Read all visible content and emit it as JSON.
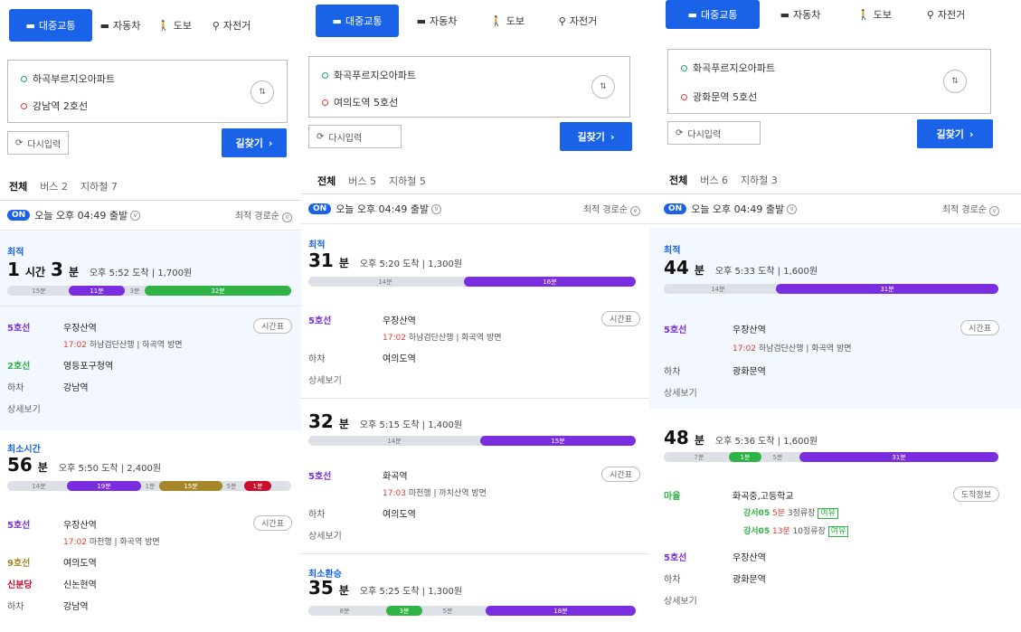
{
  "modes": {
    "transit": "대중교통",
    "car": "자동차",
    "walk": "도보",
    "bike": "자전거"
  },
  "common": {
    "later": "다시입력",
    "find": "길찾기",
    "timetable": "시간표",
    "detail": "상세보기",
    "alight": "하차",
    "sort": "최적 경로순"
  },
  "panel1": {
    "origin": "하곡부르지오아파트",
    "dest": "강남역 2호선",
    "tabs": [
      "전체",
      "버스 2",
      "지하철 7"
    ],
    "departure": "오늘 오후 04:49 출발",
    "route1": {
      "label": "최적",
      "time_a": "1",
      "unit_a": "시간",
      "time_b": "3",
      "unit_b": "분",
      "meta": "오후 5:52 도착 | 1,700원",
      "segs": [
        "15분",
        "11분",
        "3분",
        "32분"
      ],
      "leg1_line": "5호선",
      "leg1_stn": "우장산역",
      "leg1_sub_time": "17:02",
      "leg1_sub": "하남검단산행 | 하곡역 방면",
      "leg2_line": "2호선",
      "leg2_stn": "영등포구청역",
      "alight_stn": "강남역"
    },
    "route2": {
      "label": "최소시간",
      "time": "56",
      "unit": "분",
      "meta": "오후 5:50 도착 | 2,400원",
      "segs": [
        "14분",
        "19분",
        "1분",
        "15분",
        "5분",
        "1분"
      ],
      "leg1_line": "5호선",
      "leg1_stn": "우장산역",
      "leg1_sub_time": "17:02",
      "leg1_sub": "마천행 | 화곡역 방면",
      "leg2_line": "9호선",
      "leg2_stn": "여의도역",
      "leg3_line": "신분당",
      "leg3_stn": "신논현역",
      "alight_stn": "강남역"
    }
  },
  "panel2": {
    "origin": "화곡푸르지오아파트",
    "dest": "여의도역 5호선",
    "tabs": [
      "전체",
      "버스 5",
      "지하철 5"
    ],
    "departure": "오늘 오후 04:49 출발",
    "route1": {
      "label": "최적",
      "time": "31",
      "unit": "분",
      "meta": "오후 5:20 도착 | 1,300원",
      "segs": [
        "14분",
        "16분"
      ],
      "leg1_line": "5호선",
      "leg1_stn": "우장산역",
      "leg1_sub_time": "17:02",
      "leg1_sub": "하남검단산행 | 화곡역 방면",
      "alight_stn": "여의도역"
    },
    "route2": {
      "time": "32",
      "unit": "분",
      "meta": "오후 5:15 도착 | 1,400원",
      "segs": [
        "14분",
        "15분"
      ],
      "leg1_line": "5호선",
      "leg1_stn": "화곡역",
      "leg1_sub_time": "17:03",
      "leg1_sub": "마천행 | 까치산역 방면",
      "alight_stn": "여의도역"
    },
    "route3": {
      "label": "최소환승",
      "time": "35",
      "unit": "분",
      "meta": "오후 5:25 도착 | 1,300원",
      "segs": [
        "8분",
        "3분",
        "5분",
        "18분"
      ]
    }
  },
  "panel3": {
    "origin": "화곡푸르지오아파트",
    "dest": "광화문역 5호선",
    "tabs": [
      "전체",
      "버스 6",
      "지하철 3"
    ],
    "departure": "오늘 오후 04:49 출발",
    "route1": {
      "label": "최적",
      "time": "44",
      "unit": "분",
      "meta": "오후 5:33 도착 | 1,600원",
      "segs": [
        "14분",
        "31분"
      ],
      "leg1_line": "5호선",
      "leg1_stn": "우장산역",
      "leg1_sub_time": "17:02",
      "leg1_sub": "하남검단산행 | 화곡역 방면",
      "alight_stn": "광화문역"
    },
    "route2": {
      "time": "48",
      "unit": "분",
      "meta": "오후 5:36 도착 | 1,600원",
      "segs": [
        "7분",
        "1분",
        "5분",
        "31분"
      ],
      "leg1_line": "마을",
      "leg1_stn": "화곡중,고등학교",
      "info": "도착정보",
      "bus1": "강서05",
      "bus1_eta": "5분",
      "bus1_stops": "3정류장",
      "bus1_tag": "여유",
      "bus2": "강서05",
      "bus2_eta": "13분",
      "bus2_stops": "10정류장",
      "bus2_tag": "여유",
      "leg2_line": "5호선",
      "leg2_stn": "우장산역",
      "alight_stn": "광화문역"
    }
  },
  "colors": {
    "blue": "#1a63e8",
    "purple": "#7a2ee0",
    "green": "#2fb344",
    "brown": "#a8872a",
    "red": "#c8102e"
  }
}
